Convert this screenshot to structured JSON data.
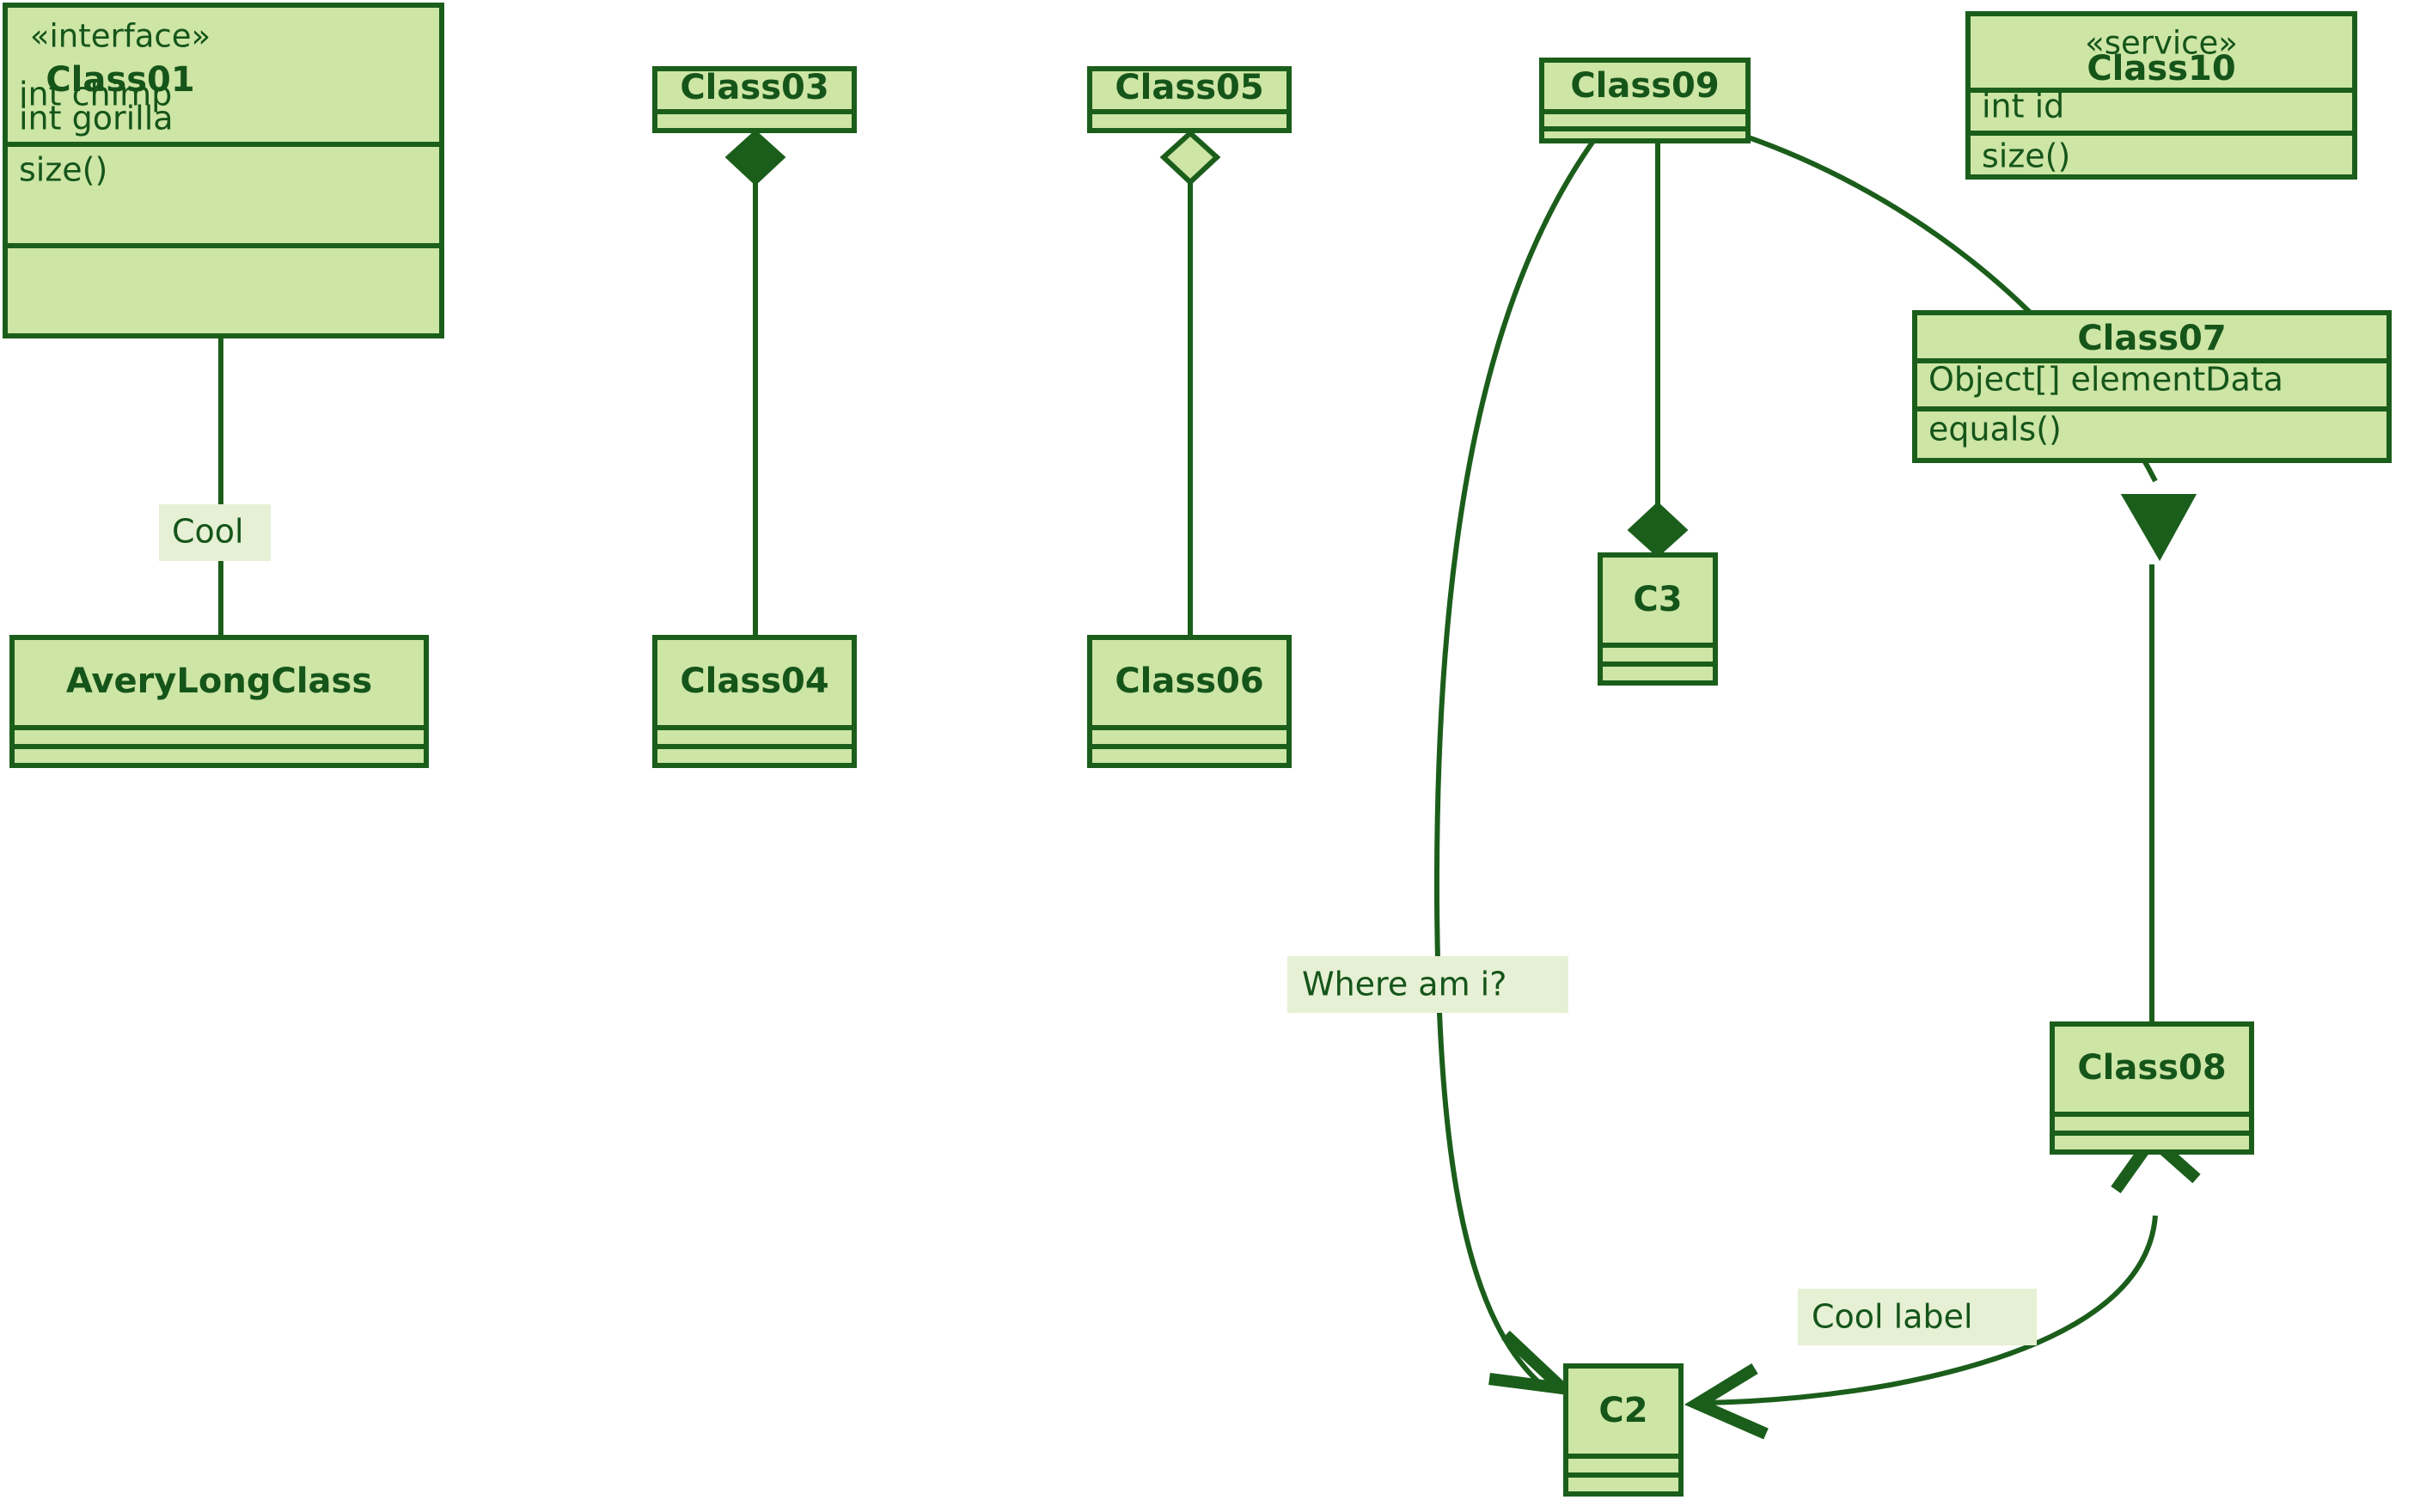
{
  "diagram": {
    "kind": "uml-class-diagram",
    "colors": {
      "background": "#ffffff",
      "node_fill": "#cde5a5",
      "stroke": "#1b5e1b",
      "text": "#15551a",
      "label_background": "#e6f0d4"
    },
    "classes": [
      {
        "id": "Class01",
        "stereotype": "«interface»",
        "name": "Class01",
        "attributes": [
          "int chimp",
          "int gorilla"
        ],
        "methods": [
          "size()"
        ]
      },
      {
        "id": "AveryLongClass",
        "stereotype": "",
        "name": "AveryLongClass",
        "attributes": [],
        "methods": []
      },
      {
        "id": "Class03",
        "stereotype": "",
        "name": "Class03",
        "attributes": [],
        "methods": []
      },
      {
        "id": "Class04",
        "stereotype": "",
        "name": "Class04",
        "attributes": [],
        "methods": []
      },
      {
        "id": "Class05",
        "stereotype": "",
        "name": "Class05",
        "attributes": [],
        "methods": []
      },
      {
        "id": "Class06",
        "stereotype": "",
        "name": "Class06",
        "attributes": [],
        "methods": []
      },
      {
        "id": "Class09",
        "stereotype": "",
        "name": "Class09",
        "attributes": [],
        "methods": []
      },
      {
        "id": "Class10",
        "stereotype": "«service»",
        "name": "Class10",
        "attributes": [
          "int id"
        ],
        "methods": [
          "size()"
        ]
      },
      {
        "id": "Class07",
        "stereotype": "",
        "name": "Class07",
        "attributes": [
          "Object[] elementData"
        ],
        "methods": [
          "equals()"
        ]
      },
      {
        "id": "Class08",
        "stereotype": "",
        "name": "Class08",
        "attributes": [],
        "methods": []
      },
      {
        "id": "C3",
        "stereotype": "",
        "name": "C3",
        "attributes": [],
        "methods": []
      },
      {
        "id": "C2",
        "stereotype": "",
        "name": "C2",
        "attributes": [],
        "methods": []
      }
    ],
    "relationships": [
      {
        "from": "AveryLongClass",
        "to": "Class01",
        "type": "inheritance",
        "end_marker": "filled-triangle",
        "label": "Cool"
      },
      {
        "from": "Class04",
        "to": "Class03",
        "type": "composition",
        "end_marker": "filled-diamond",
        "label": ""
      },
      {
        "from": "Class06",
        "to": "Class05",
        "type": "aggregation",
        "end_marker": "hollow-diamond",
        "label": ""
      },
      {
        "from": "Class09",
        "to": "C2",
        "type": "association",
        "end_marker": "open-arrow",
        "label": "Where am i?"
      },
      {
        "from": "Class09",
        "to": "C3",
        "type": "composition",
        "end_marker": "filled-diamond",
        "label": ""
      },
      {
        "from": "Class09",
        "to": "Class07",
        "type": "inheritance",
        "end_marker": "filled-triangle",
        "label": ""
      },
      {
        "from": "Class07",
        "to": "Class08",
        "type": "link",
        "end_marker": "none",
        "label": ""
      },
      {
        "from": "Class08",
        "to": "C2",
        "type": "association",
        "end_marker": "open-arrow",
        "label": "Cool label"
      }
    ],
    "edge_labels": [
      {
        "id": "cool",
        "text": "Cool"
      },
      {
        "id": "where_am_i",
        "text": "Where am i?"
      },
      {
        "id": "cool_label",
        "text": "Cool label"
      }
    ]
  }
}
